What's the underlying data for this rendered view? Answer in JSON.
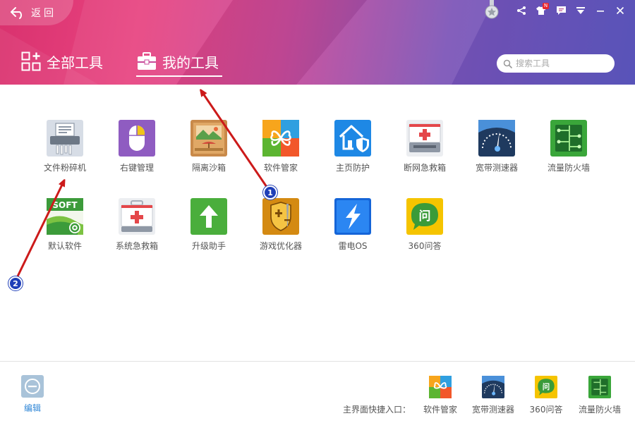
{
  "header": {
    "back_label": "返回",
    "tabs": [
      {
        "label": "全部工具",
        "active": false
      },
      {
        "label": "我的工具",
        "active": true
      }
    ],
    "search": {
      "placeholder": "搜索工具",
      "value": ""
    },
    "notification_badge": "N"
  },
  "tools": [
    {
      "label": "文件粉碎机",
      "icon": "file-shredder-icon"
    },
    {
      "label": "右键管理",
      "icon": "right-click-mouse-icon"
    },
    {
      "label": "隔离沙箱",
      "icon": "sandbox-icon"
    },
    {
      "label": "软件管家",
      "icon": "software-manager-icon"
    },
    {
      "label": "主页防护",
      "icon": "homepage-shield-icon"
    },
    {
      "label": "断网急救箱",
      "icon": "network-first-aid-icon"
    },
    {
      "label": "宽带测速器",
      "icon": "speed-gauge-icon"
    },
    {
      "label": "流量防火墙",
      "icon": "traffic-firewall-icon"
    },
    {
      "label": "默认软件",
      "icon": "default-software-icon"
    },
    {
      "label": "系统急救箱",
      "icon": "system-first-aid-icon"
    },
    {
      "label": "升级助手",
      "icon": "upgrade-arrow-icon"
    },
    {
      "label": "游戏优化器",
      "icon": "game-optimizer-shield-icon"
    },
    {
      "label": "雷电OS",
      "icon": "lightning-os-icon"
    },
    {
      "label": "360问答",
      "icon": "qa-bubble-icon"
    }
  ],
  "icon_texts": {
    "default_software": "SOFT",
    "qa_glyph": "问"
  },
  "annotations": [
    {
      "number": "1"
    },
    {
      "number": "2"
    }
  ],
  "footer": {
    "edit_label": "编辑",
    "shortcut_caption": "主界面快捷入口：",
    "shortcuts": [
      {
        "label": "软件管家"
      },
      {
        "label": "宽带测速器"
      },
      {
        "label": "360问答"
      },
      {
        "label": "流量防火墙"
      }
    ]
  },
  "colors": {
    "header_pink": "#e84380",
    "header_purple": "#5f5bc0",
    "annotation_arrow": "#cc1a1a",
    "annotation_badge": "#1f3fb8",
    "edit_blue": "#2e86d6"
  }
}
